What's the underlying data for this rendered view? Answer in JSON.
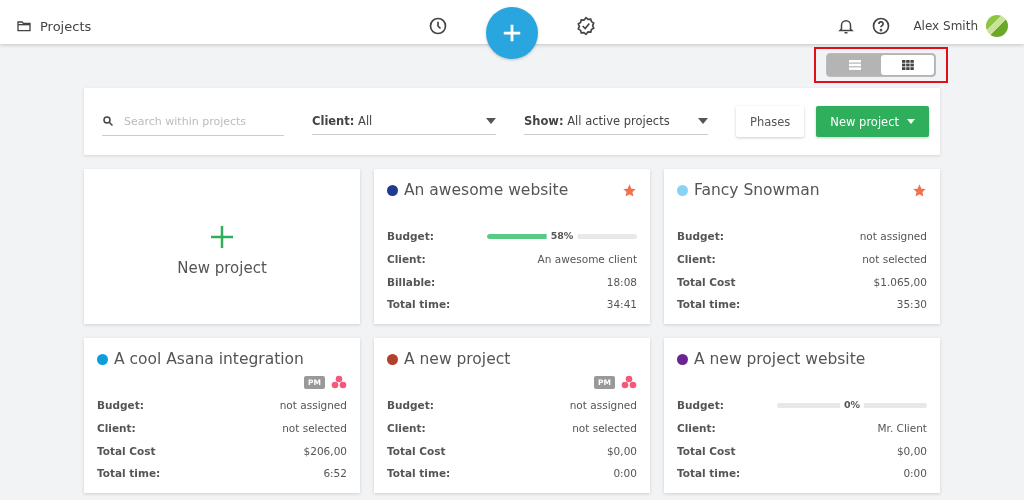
{
  "header": {
    "title": "Projects",
    "user": "Alex Smith"
  },
  "view_toggle": {
    "highlighted": true,
    "options": [
      {
        "kind": "list",
        "selected": false
      },
      {
        "kind": "grid",
        "selected": true
      }
    ]
  },
  "filters": {
    "search": {
      "placeholder": "Search within projects"
    },
    "client": {
      "label": "Client:",
      "value": "All"
    },
    "show": {
      "label": "Show:",
      "value": "All active projects"
    },
    "phases_button": "Phases",
    "new_button": "New project"
  },
  "cards": [
    {
      "kind": "new",
      "label": "New project"
    },
    {
      "kind": "project",
      "name": "An awesome website",
      "color": "#1f3a93",
      "starred": true,
      "rows": [
        {
          "kind": "bar",
          "label": "Budget:",
          "level": 0.58,
          "reading": "58%"
        },
        {
          "kind": "text",
          "label": "Client:",
          "value": "An awesome client"
        },
        {
          "kind": "text",
          "label": "Billable:",
          "value": "18:08"
        },
        {
          "kind": "text",
          "label": "Total time:",
          "value": "34:41"
        }
      ]
    },
    {
      "kind": "project",
      "name": "Fancy Snowman",
      "color": "#87d3f5",
      "starred": true,
      "rows": [
        {
          "kind": "text",
          "label": "Budget:",
          "value": "not assigned"
        },
        {
          "kind": "text",
          "label": "Client:",
          "value": "not selected"
        },
        {
          "kind": "text",
          "label": "Total Cost",
          "value": "$1.065,00"
        },
        {
          "kind": "text",
          "label": "Total time:",
          "value": "35:30"
        }
      ]
    },
    {
      "kind": "project",
      "name": "A cool Asana integration",
      "color": "#0d9ddb",
      "starred": false,
      "badge": "PM",
      "rows": [
        {
          "kind": "text",
          "label": "Budget:",
          "value": "not assigned"
        },
        {
          "kind": "text",
          "label": "Client:",
          "value": "not selected"
        },
        {
          "kind": "text",
          "label": "Total Cost",
          "value": "$206,00"
        },
        {
          "kind": "text",
          "label": "Total time:",
          "value": "6:52"
        }
      ]
    },
    {
      "kind": "project",
      "name": "A new project",
      "color": "#b0412e",
      "starred": false,
      "badge": "PM",
      "rows": [
        {
          "kind": "text",
          "label": "Budget:",
          "value": "not assigned"
        },
        {
          "kind": "text",
          "label": "Client:",
          "value": "not selected"
        },
        {
          "kind": "text",
          "label": "Total Cost",
          "value": "$0,00"
        },
        {
          "kind": "text",
          "label": "Total time:",
          "value": "0:00"
        }
      ]
    },
    {
      "kind": "project",
      "name": "A new project website",
      "color": "#6a2590",
      "starred": false,
      "rows": [
        {
          "kind": "bar",
          "label": "Budget:",
          "level": 0,
          "reading": "0%"
        },
        {
          "kind": "text",
          "label": "Client:",
          "value": "Mr. Client"
        },
        {
          "kind": "text",
          "label": "Total Cost",
          "value": "$0,00"
        },
        {
          "kind": "text",
          "label": "Total time:",
          "value": "0:00"
        }
      ]
    }
  ]
}
